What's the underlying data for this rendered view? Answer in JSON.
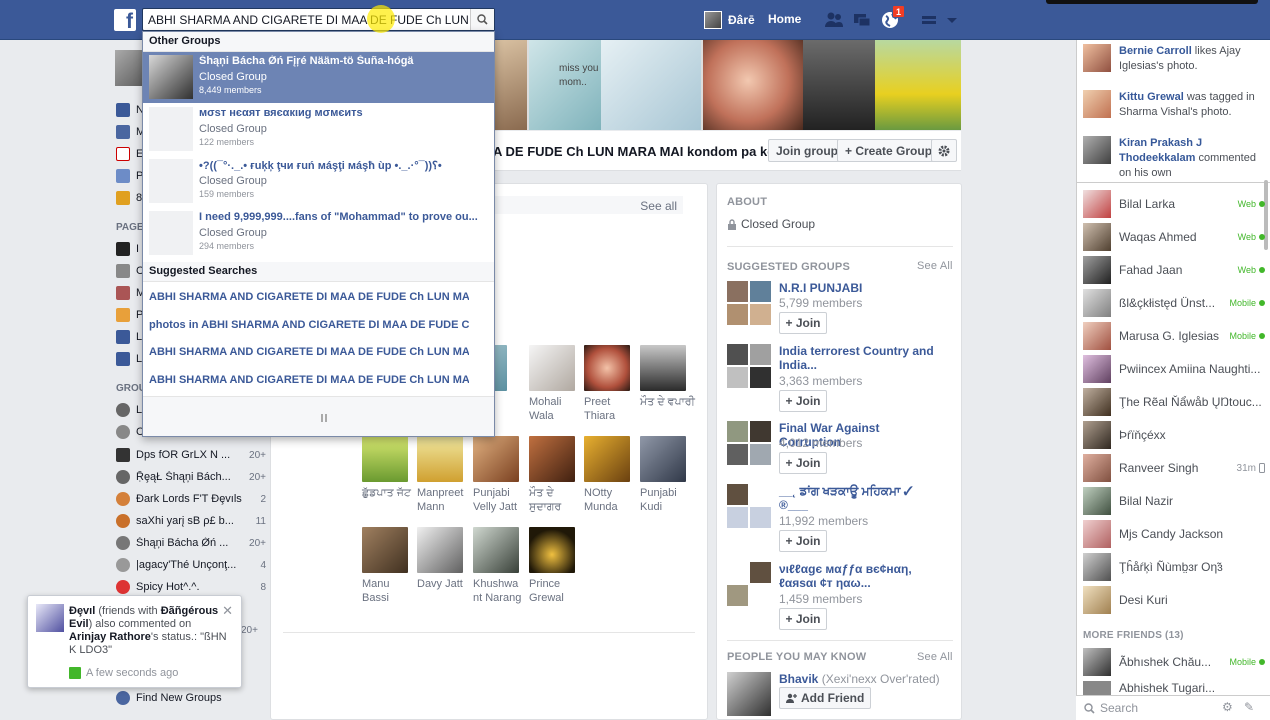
{
  "header": {
    "search_value": "ABHI SHARMA AND CIGARETE DI MAA DE FUDE Ch LUN",
    "user_name": "Ðârē",
    "home_label": "Home",
    "notification_count": "1"
  },
  "dropdown": {
    "other_groups_label": "Other Groups",
    "groups": [
      {
        "name": "Šhąņi Bácha Ǿń Fįŗé Nääm-tö Šuña-hógä",
        "type": "Closed Group",
        "members": "8,449 members"
      },
      {
        "name": "мσѕт нєαят вяєαкιиg мσмєитѕ",
        "type": "Closed Group",
        "members": "122 members"
      },
      {
        "name": "•?((¯°·._.• ғuķķ ţчи ғuń мáşţi мáşћ ùp •._.·°¯))؟•",
        "type": "Closed Group",
        "members": "159 members"
      },
      {
        "name": "I need 9,999,999....fans of \"Mohammad\" to prove ou...",
        "type": "Closed Group",
        "members": "294 members"
      }
    ],
    "suggested_label": "Suggested Searches",
    "suggestions": [
      "ABHI SHARMA AND CIGARETE DI MAA DE FUDE Ch LUN MARA ...",
      "photos in ABHI SHARMA AND CIGARETE DI MAA DE FUDE Ch L...",
      "ABHI SHARMA AND CIGARETE DI MAA DE FUDE Ch LUN MARA ...",
      "ABHI SHARMA AND CIGARETE DI MAA DE FUDE Ch LUN MARA ..."
    ]
  },
  "left_nav": {
    "items_top": [
      "N",
      "M",
      "E",
      "P",
      "8"
    ],
    "pages_head": "PAGE",
    "pages": [
      "I",
      "C",
      "M",
      "P",
      "L",
      "L"
    ],
    "groups_head": "GROU",
    "groups": [
      {
        "label": "L",
        "count": ""
      },
      {
        "label": "C",
        "count": ""
      },
      {
        "label": "Dps fOR GrLX N ...",
        "count": "20+"
      },
      {
        "label": "ṜȩąŁ Šhąņi Bách...",
        "count": "20+"
      },
      {
        "label": "Ðark Lords F'T Ðȩvıls",
        "count": "2"
      },
      {
        "label": "saXhi yarį sB ρ£ b...",
        "count": "11"
      },
      {
        "label": "Šhąņi Bácha Ǿń ...",
        "count": "20+"
      },
      {
        "label": "|agacy'Thé Unçonţ...",
        "count": "4"
      },
      {
        "label": "Spicy Hot^.^.",
        "count": "8"
      }
    ],
    "count_20": "20+",
    "find_groups": "Find New Groups"
  },
  "cover": {
    "miss_text": "miss you mom..",
    "title": "A DE FUDE Ch LUN MARA MAI kondom pa ke",
    "join_label": "Join group",
    "create_label": "+ Create Group"
  },
  "members_card": {
    "see_all": "See all",
    "rows": [
      [
        "il",
        "a",
        "Mohali Wala",
        "Preet Thiara",
        "ਮੌਤ ਦੇ ਵਪਾਰੀ"
      ],
      [
        "ਛੁੱਡਪਾਤ ਜੱਟ",
        "Manpreet Mann",
        "Punjabi Velly Jatt",
        "ਮੌਤ ਦੇ ਸੁਦਾਗਰ",
        "NOtty Munda",
        "Punjabi Kudi"
      ],
      [
        "Manu Bassi",
        "Davy Jatt",
        "Khushwa nt Narang",
        "Prince Grewal"
      ]
    ]
  },
  "about": {
    "head": "ABOUT",
    "privacy": "Closed Group",
    "suggested_head": "SUGGESTED GROUPS",
    "see_all": "See All",
    "join_label": "+ Join",
    "suggested": [
      {
        "name": "N.R.I PUNJABI",
        "members": "5,799 members"
      },
      {
        "name": "India terrorest Country and India...",
        "members": "3,363 members"
      },
      {
        "name": "Final War Against Corruption",
        "members": "4,012 members"
      },
      {
        "name": "__˛ ਡਾਂਗ ਖੜਕਾਊ ਮਹਿਕਮਾ ✓ ®___",
        "members": "11,992 members"
      },
      {
        "name": "νιℓℓαgє мαƒƒα вє¢нαη, ℓαяѕαι ¢т ηαω...",
        "members": "1,459 members"
      }
    ],
    "people_head": "PEOPLE YOU MAY KNOW",
    "person": {
      "name": "Bhavik",
      "extra": "(Xexi'nexx Over'rated)",
      "add_label": "Add Friend"
    }
  },
  "ticker": [
    {
      "name": "Bernie Carroll",
      "text": " likes Ajay Iglesias's photo."
    },
    {
      "name": "Kittu Grewal",
      "text": " was tagged in Sharma Vishal's photo."
    },
    {
      "name": "Kiran Prakash J Thodeekkalam",
      "text": " commented on his own"
    }
  ],
  "chat": {
    "contacts": [
      {
        "name": "Bilal Larka",
        "status": "Web"
      },
      {
        "name": "Waqas Ahmed",
        "status": "Web"
      },
      {
        "name": "Fahad Jaan",
        "status": "Web"
      },
      {
        "name": "ßl&çkłistęd Ünst...",
        "status": "Mobile"
      },
      {
        "name": "Marusa G. Iglesias",
        "status": "Mobile"
      },
      {
        "name": "Pwiincex Amiina Naughti...",
        "status": ""
      },
      {
        "name": "Ţhe Rẽal Ňẩwåb ŲŊtouc...",
        "status": ""
      },
      {
        "name": "Þŕïňçéxx",
        "status": ""
      },
      {
        "name": "Ranveer Singh",
        "status": "31m"
      },
      {
        "name": "Bilal Nazir",
        "status": ""
      },
      {
        "name": "Mjs Candy Jackson",
        "status": ""
      },
      {
        "name": "Ţĥåŕķì Ñùmb̤ɜr Oη̃ɜ",
        "status": ""
      },
      {
        "name": "Desi Kuri",
        "status": ""
      }
    ],
    "more_head": "MORE FRIENDS (13)",
    "more": [
      {
        "name": "Ãbhıshek Chău...",
        "status": "Mobile"
      }
    ],
    "partial": "Abhishek Tugari...",
    "search_placeholder": "Search"
  },
  "notification": {
    "actor": "Ðȩvıl",
    "text1": " (friends with ",
    "friend": "Ðãñgérous Evil",
    "text2": ") also commented on ",
    "target": "Arinjay Rathore",
    "text3": "'s status.: \"ßHN K LDO3\"",
    "time": "A few seconds ago"
  }
}
